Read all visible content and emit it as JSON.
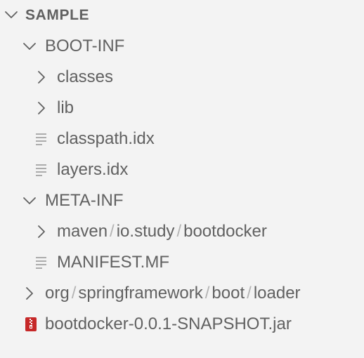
{
  "explorer": {
    "section_title": "SAMPLE",
    "items": [
      {
        "label": "BOOT-INF",
        "twisty": "chevron-down-icon"
      },
      {
        "label": "classes",
        "twisty": "chevron-right-icon"
      },
      {
        "label": "lib",
        "twisty": "chevron-right-icon"
      },
      {
        "label": "classpath.idx",
        "icon": "text-file-icon"
      },
      {
        "label": "layers.idx",
        "icon": "text-file-icon"
      },
      {
        "label": "META-INF",
        "twisty": "chevron-down-icon"
      },
      {
        "twisty": "chevron-right-icon",
        "compact_path": [
          "maven",
          "io.study",
          "bootdocker"
        ],
        "separator": "/"
      },
      {
        "label": "MANIFEST.MF",
        "icon": "text-file-icon"
      },
      {
        "twisty": "chevron-right-icon",
        "compact_path": [
          "org",
          "springframework",
          "boot",
          "loader"
        ],
        "separator": "/"
      },
      {
        "label": "bootdocker-0.0.1-SNAPSHOT.jar",
        "icon": "zip-archive-icon"
      }
    ]
  },
  "colors": {
    "background": "#f3f3f3",
    "text": "#616161",
    "separator": "#b4b4b4",
    "archive_icon": "#c62828"
  }
}
